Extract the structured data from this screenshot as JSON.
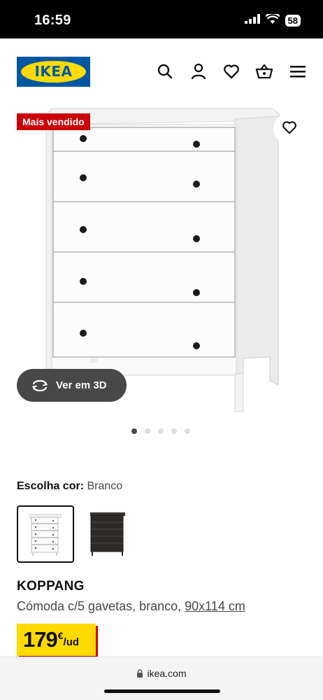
{
  "status_bar": {
    "time": "16:59",
    "battery": "58"
  },
  "header": {
    "logo": "IKEA",
    "icons": [
      "search-icon",
      "person-icon",
      "heart-icon",
      "basket-icon",
      "menu-icon"
    ]
  },
  "product_image": {
    "badge": "Mais vendido",
    "view_3d_label": "Ver em 3D",
    "carousel": {
      "count": 5,
      "active": 1
    }
  },
  "color": {
    "label": "Escolha cor:",
    "value": "Branco",
    "options": [
      "white",
      "black-brown"
    ],
    "selected": 1
  },
  "product": {
    "name": "KOPPANG",
    "description": "Cómoda c/5 gavetas, branco, ",
    "dimensions": "90x114 cm",
    "price": "179",
    "currency": "€",
    "unit": "/ud"
  },
  "browser": {
    "url": "ikea.com"
  },
  "colors": {
    "ikea_blue": "#0058a3",
    "ikea_yellow": "#ffdb00",
    "badge_red": "#cc0008"
  }
}
